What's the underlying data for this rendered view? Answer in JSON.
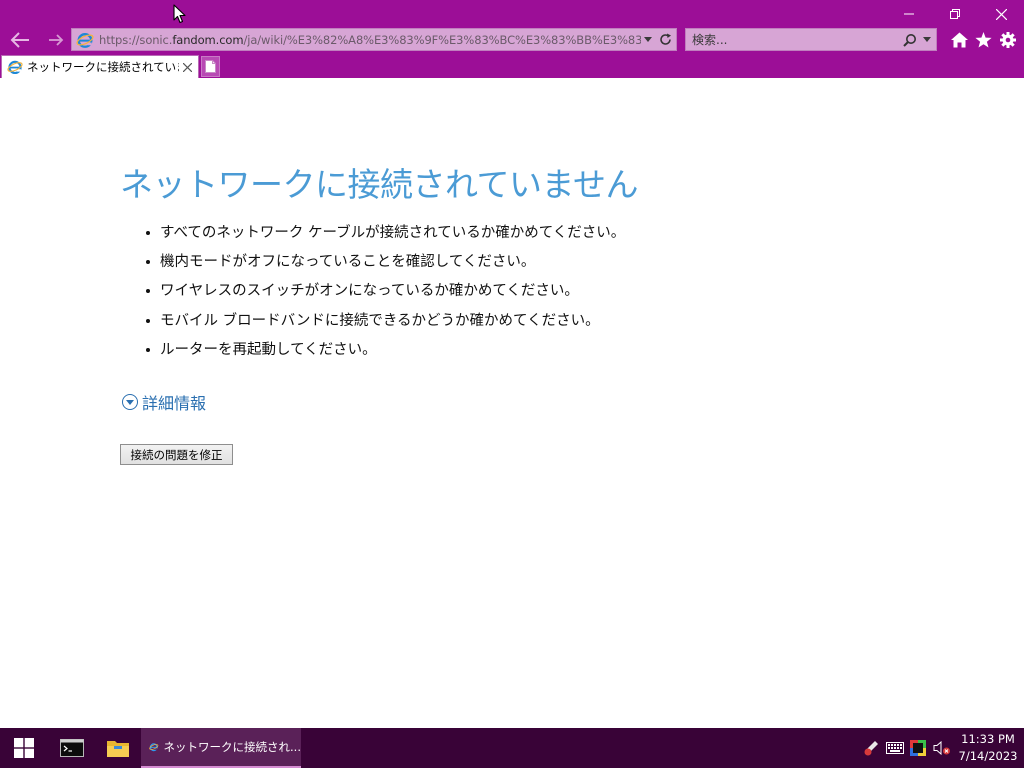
{
  "browser": {
    "url_prefix": "https://sonic.",
    "url_host": "fandom.com",
    "url_path": "/ja/wiki/%E3%82%A8%E3%83%9F%E3%83%BC%E3%83%BB%E3%83%AD%E3",
    "search_placeholder": "検索...",
    "tab_title": "ネットワークに接続されていません",
    "accent_color": "#9c0e97"
  },
  "error_page": {
    "heading": "ネットワークに接続されていません",
    "tips": [
      "すべてのネットワーク ケーブルが接続されているか確かめてください。",
      "機内モードがオフになっていることを確認してください。",
      "ワイヤレスのスイッチがオンになっているか確かめてください。",
      "モバイル ブロードバンドに接続できるかどうか確かめてください。",
      "ルーターを再起動してください。"
    ],
    "more_info_label": "詳細情報",
    "fix_button_label": "接続の問題を修正",
    "heading_color": "#4b9bd5"
  },
  "taskbar": {
    "ie_window_label": "ネットワークに接続され...",
    "time": "11:33 PM",
    "date": "7/14/2023"
  }
}
